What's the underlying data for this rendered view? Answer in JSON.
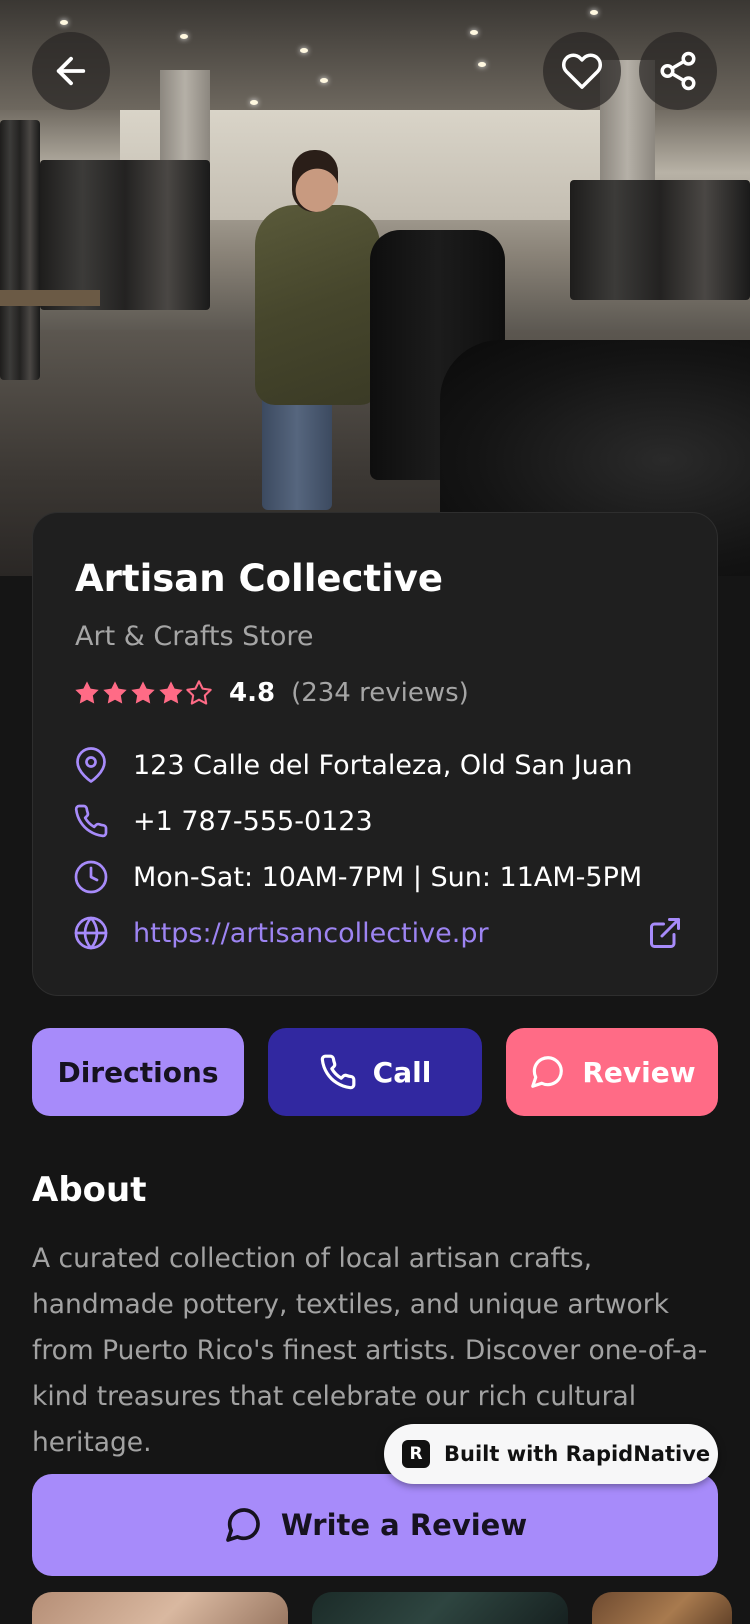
{
  "place": {
    "name": "Artisan Collective",
    "category": "Art & Crafts Store",
    "rating": "4.8",
    "rating_stars": 4.8,
    "review_count": "(234 reviews)",
    "address": "123 Calle del Fortaleza, Old San Juan",
    "phone": "+1 787-555-0123",
    "hours": "Mon-Sat: 10AM-7PM | Sun: 11AM-5PM",
    "website": "https://artisancollective.pr"
  },
  "actions": {
    "directions": "Directions",
    "call": "Call",
    "review": "Review"
  },
  "about": {
    "title": "About",
    "text": "A curated collection of local artisan crafts, handmade pottery, textiles, and unique artwork from Puerto Rico's finest artists. Discover one-of-a-kind treasures that celebrate our rich cultural heritage."
  },
  "badge": {
    "logo": "R",
    "text": "Built with RapidNative"
  },
  "write_review": "Write a Review",
  "icons": {
    "back": "arrow-left-icon",
    "favorite": "heart-icon",
    "share": "share-icon",
    "address": "map-pin-icon",
    "phone": "phone-icon",
    "hours": "clock-icon",
    "website": "globe-icon",
    "external": "external-link-icon",
    "review": "message-circle-icon"
  },
  "colors": {
    "accent": "#a78bfa",
    "call": "#3128a0",
    "review": "#ff6b86",
    "star": "#ff6b86",
    "link": "#9d84f2",
    "background": "#151515",
    "card": "#1f1f1f"
  }
}
